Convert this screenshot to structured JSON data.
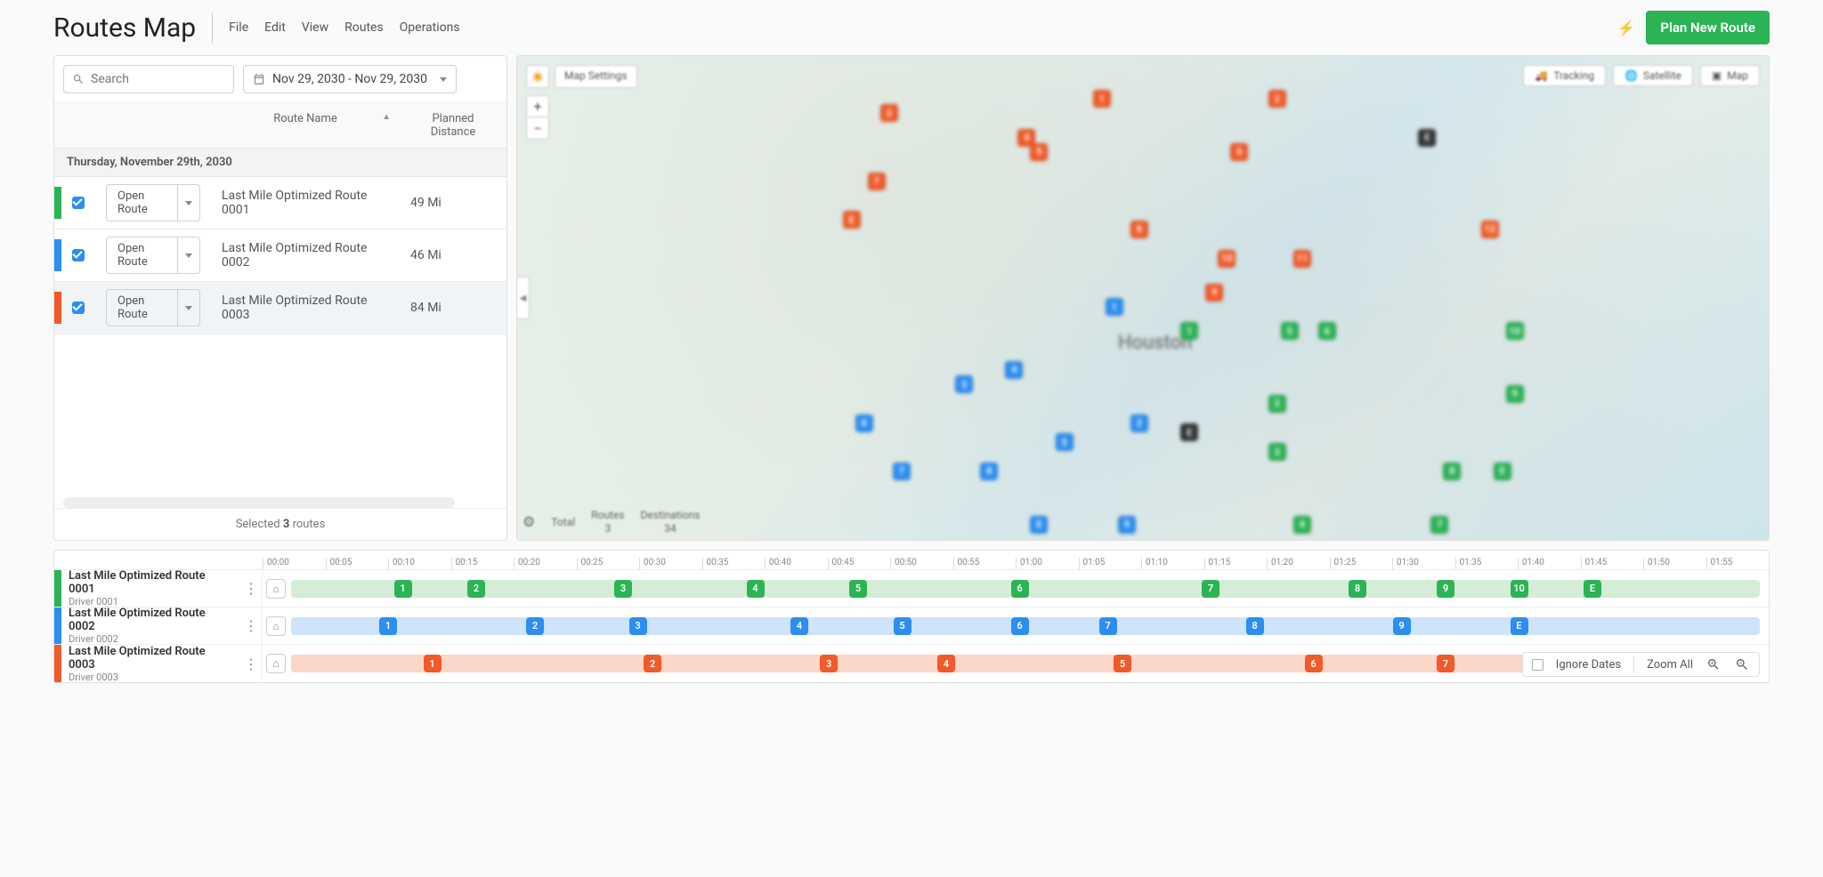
{
  "header": {
    "title": "Routes Map",
    "menu": [
      "File",
      "Edit",
      "View",
      "Routes",
      "Operations"
    ],
    "plan_button": "Plan New Route"
  },
  "search": {
    "placeholder": "Search"
  },
  "date_range": "Nov 29, 2030 - Nov 29, 2030",
  "table": {
    "headers": {
      "name": "Route Name",
      "distance": "Planned Distance"
    },
    "group": "Thursday, November 29th, 2030",
    "open_label": "Open Route",
    "rows": [
      {
        "color": "#2cb355",
        "name": "Last Mile Optimized Route 0001",
        "distance": "49 Mi"
      },
      {
        "color": "#2c8ef0",
        "name": "Last Mile Optimized Route 0002",
        "distance": "46 Mi"
      },
      {
        "color": "#f15a29",
        "name": "Last Mile Optimized Route 0003",
        "distance": "84 Mi"
      }
    ],
    "footer": {
      "pre": "Selected ",
      "count": "3",
      "post": " routes"
    }
  },
  "map": {
    "settings_label": "Map Settings",
    "toggles": {
      "tracking": "Tracking",
      "satellite": "Satellite",
      "map": "Map"
    },
    "city_label": "Houston",
    "footer": {
      "total_label": "Total",
      "routes_label": "Routes",
      "routes_value": "3",
      "dest_label": "Destinations",
      "dest_value": "34"
    }
  },
  "timeline": {
    "ticks": [
      "00:00",
      "00:05",
      "00:10",
      "00:15",
      "00:20",
      "00:25",
      "00:30",
      "00:35",
      "00:40",
      "00:45",
      "00:50",
      "00:55",
      "01:00",
      "01:05",
      "01:10",
      "01:15",
      "01:20",
      "01:25",
      "01:30",
      "01:35",
      "01:40",
      "01:45",
      "01:50",
      "01:55"
    ],
    "rows": [
      {
        "color": "#2cb355",
        "light": "#d5ecd7",
        "name": "Last Mile Optimized Route 0001",
        "driver": "Driver 0001",
        "stops": [
          {
            "l": "1",
            "p": 7
          },
          {
            "l": "2",
            "p": 12
          },
          {
            "l": "3",
            "p": 22
          },
          {
            "l": "4",
            "p": 31
          },
          {
            "l": "5",
            "p": 38
          },
          {
            "l": "6",
            "p": 49
          },
          {
            "l": "7",
            "p": 62
          },
          {
            "l": "8",
            "p": 72
          },
          {
            "l": "9",
            "p": 78
          },
          {
            "l": "10",
            "p": 83
          },
          {
            "l": "E",
            "p": 88
          }
        ]
      },
      {
        "color": "#2c8ef0",
        "light": "#cfe3fa",
        "name": "Last Mile Optimized Route 0002",
        "driver": "Driver 0002",
        "stops": [
          {
            "l": "1",
            "p": 6
          },
          {
            "l": "2",
            "p": 16
          },
          {
            "l": "3",
            "p": 23
          },
          {
            "l": "4",
            "p": 34
          },
          {
            "l": "5",
            "p": 41
          },
          {
            "l": "6",
            "p": 49
          },
          {
            "l": "7",
            "p": 55
          },
          {
            "l": "8",
            "p": 65
          },
          {
            "l": "9",
            "p": 75
          },
          {
            "l": "E",
            "p": 83
          }
        ]
      },
      {
        "color": "#f15a29",
        "light": "#fbd6c9",
        "name": "Last Mile Optimized Route 0003",
        "driver": "Driver 0003",
        "stops": [
          {
            "l": "1",
            "p": 9
          },
          {
            "l": "2",
            "p": 24
          },
          {
            "l": "3",
            "p": 36
          },
          {
            "l": "4",
            "p": 44
          },
          {
            "l": "5",
            "p": 56
          },
          {
            "l": "6",
            "p": 69
          },
          {
            "l": "7",
            "p": 78
          }
        ]
      }
    ],
    "footer": {
      "ignore": "Ignore Dates",
      "zoom_all": "Zoom All"
    }
  },
  "markers": [
    {
      "c": "#f15a29",
      "l": "1",
      "x": 46,
      "y": 7
    },
    {
      "c": "#f15a29",
      "l": "2",
      "x": 60,
      "y": 7
    },
    {
      "c": "#f15a29",
      "l": "3",
      "x": 29,
      "y": 10
    },
    {
      "c": "#f15a29",
      "l": "4",
      "x": 40,
      "y": 15
    },
    {
      "c": "#f15a29",
      "l": "5",
      "x": 41,
      "y": 18
    },
    {
      "c": "#f15a29",
      "l": "6",
      "x": 57,
      "y": 18
    },
    {
      "c": "#f15a29",
      "l": "7",
      "x": 28,
      "y": 24
    },
    {
      "c": "#f15a29",
      "l": "8",
      "x": 49,
      "y": 34
    },
    {
      "c": "#f15a29",
      "l": "9",
      "x": 55,
      "y": 47
    },
    {
      "c": "#f15a29",
      "l": "10",
      "x": 56,
      "y": 40
    },
    {
      "c": "#f15a29",
      "l": "11",
      "x": 62,
      "y": 40
    },
    {
      "c": "#f15a29",
      "l": "12",
      "x": 77,
      "y": 34
    },
    {
      "c": "#f15a29",
      "l": "E",
      "x": 26,
      "y": 32
    },
    {
      "c": "#2c8ef0",
      "l": "1",
      "x": 47,
      "y": 50
    },
    {
      "c": "#2c8ef0",
      "l": "2",
      "x": 49,
      "y": 74
    },
    {
      "c": "#2c8ef0",
      "l": "3",
      "x": 35,
      "y": 66
    },
    {
      "c": "#2c8ef0",
      "l": "4",
      "x": 39,
      "y": 63
    },
    {
      "c": "#2c8ef0",
      "l": "5",
      "x": 43,
      "y": 78
    },
    {
      "c": "#2c8ef0",
      "l": "6",
      "x": 27,
      "y": 74
    },
    {
      "c": "#2c8ef0",
      "l": "7",
      "x": 30,
      "y": 84
    },
    {
      "c": "#2c8ef0",
      "l": "8",
      "x": 37,
      "y": 84
    },
    {
      "c": "#2c8ef0",
      "l": "9",
      "x": 48,
      "y": 95
    },
    {
      "c": "#2c8ef0",
      "l": "E",
      "x": 41,
      "y": 95
    },
    {
      "c": "#2cb355",
      "l": "1",
      "x": 53,
      "y": 55
    },
    {
      "c": "#2cb355",
      "l": "2",
      "x": 60,
      "y": 70
    },
    {
      "c": "#2cb355",
      "l": "3",
      "x": 60,
      "y": 80
    },
    {
      "c": "#2cb355",
      "l": "4",
      "x": 62,
      "y": 95
    },
    {
      "c": "#2cb355",
      "l": "5",
      "x": 61,
      "y": 55
    },
    {
      "c": "#2cb355",
      "l": "6",
      "x": 64,
      "y": 55
    },
    {
      "c": "#2cb355",
      "l": "7",
      "x": 73,
      "y": 95
    },
    {
      "c": "#2cb355",
      "l": "8",
      "x": 74,
      "y": 84
    },
    {
      "c": "#2cb355",
      "l": "9",
      "x": 79,
      "y": 68
    },
    {
      "c": "#2cb355",
      "l": "10",
      "x": 79,
      "y": 55
    },
    {
      "c": "#2cb355",
      "l": "E",
      "x": 78,
      "y": 84
    },
    {
      "c": "#333",
      "l": "E",
      "x": 72,
      "y": 15
    },
    {
      "c": "#333",
      "l": "E",
      "x": 53,
      "y": 76
    }
  ]
}
